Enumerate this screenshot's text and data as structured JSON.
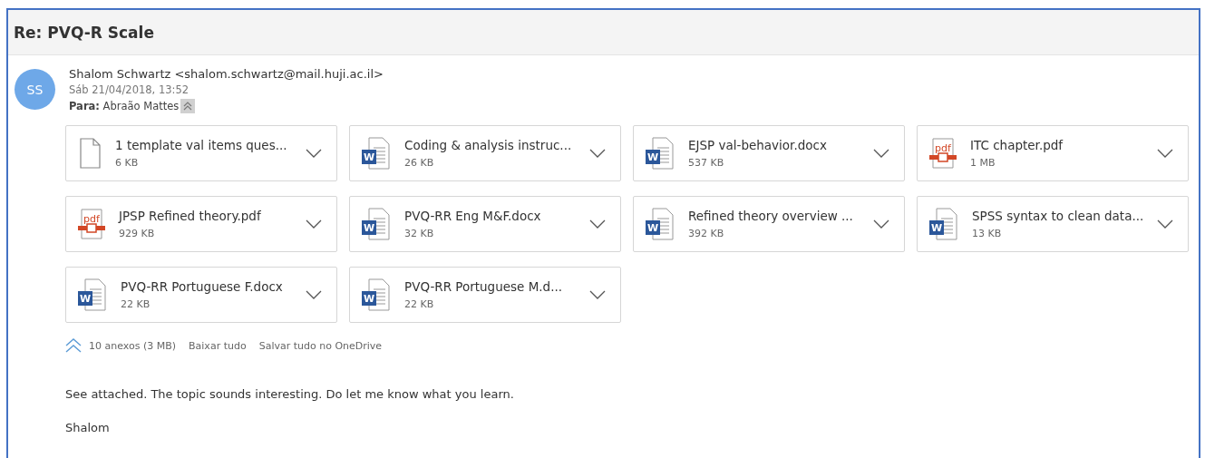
{
  "subject": "Re: PVQ-R Scale",
  "sender": {
    "initials": "SS",
    "from": "Shalom Schwartz <shalom.schwartz@mail.huji.ac.il>",
    "date": "Sáb 21/04/2018, 13:52",
    "to": "**Para:** Abraão Mattes"
  },
  "attachments": [
    {
      "name": "1 template val items ques...",
      "size": "6 KB",
      "kind": "generic"
    },
    {
      "name": "Coding & analysis instruc...",
      "size": "26 KB",
      "kind": "word",
      "icon_text": "W"
    },
    {
      "name": "EJSP val-behavior.docx",
      "size": "537 KB",
      "kind": "word",
      "icon_text": "W"
    },
    {
      "name": "ITC chapter.pdf",
      "size": "1 MB",
      "kind": "pdf",
      "icon_text": "pdf"
    },
    {
      "name": "JPSP Refined theory.pdf",
      "size": "929 KB",
      "kind": "pdf",
      "icon_text": "pdf"
    },
    {
      "name": "PVQ-RR Eng M&F.docx",
      "size": "32 KB",
      "kind": "word",
      "icon_text": "W"
    },
    {
      "name": "Refined theory overview ...",
      "size": "392 KB",
      "kind": "word",
      "icon_text": "W"
    },
    {
      "name": "SPSS syntax to clean data...",
      "size": "13 KB",
      "kind": "word",
      "icon_text": "W"
    },
    {
      "name": "PVQ-RR Portuguese F.docx",
      "size": "22 KB",
      "kind": "word",
      "icon_text": "W"
    },
    {
      "name": "PVQ-RR Portuguese M.d...",
      "size": "22 KB",
      "kind": "word",
      "icon_text": "W"
    }
  ],
  "attachment_bar": {
    "count": "10 anexos (3 MB)",
    "download_all": "Baixar tudo",
    "save_all": "Salvar tudo no OneDrive"
  },
  "body": [
    "See attached. The topic sounds interesting. Do let me know what you learn.",
    "Shalom"
  ]
}
